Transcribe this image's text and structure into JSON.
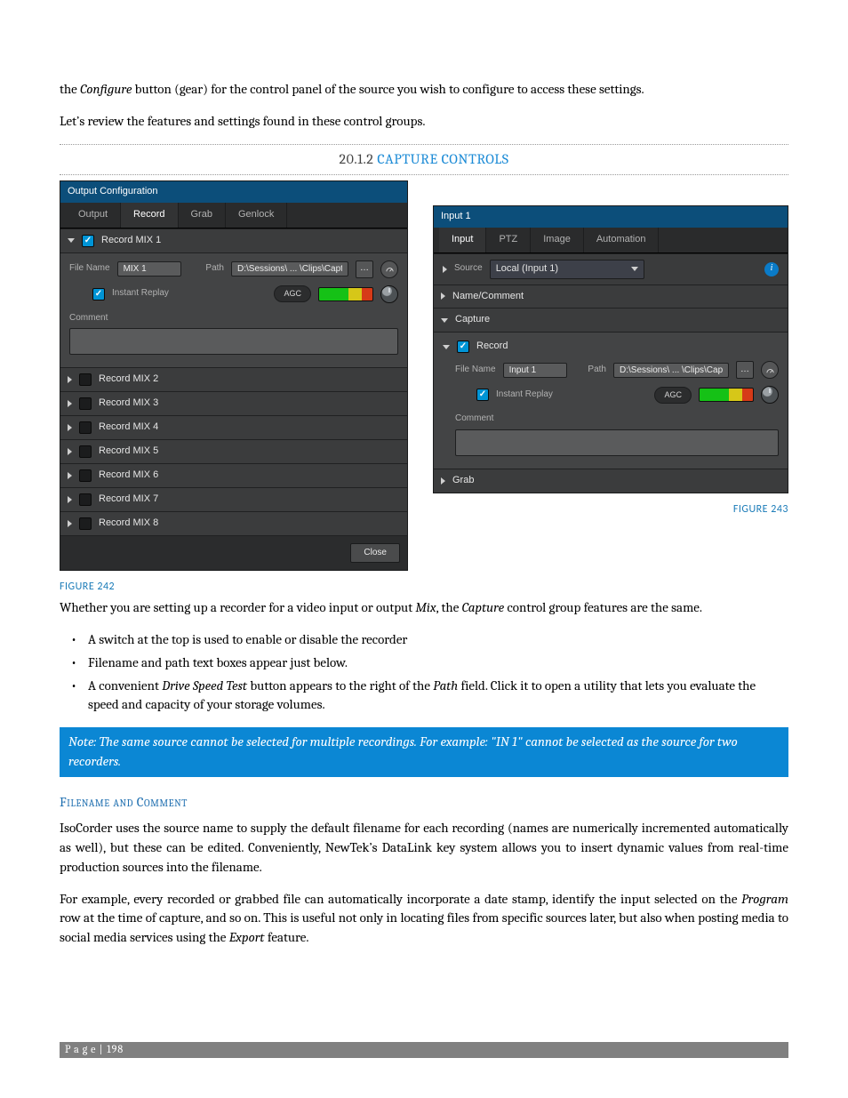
{
  "intro1_a": "the ",
  "intro1_b": "Configure",
  "intro1_c": " button (gear) for the control panel of the source you wish to configure to access these settings.",
  "intro2": "Let’s review the features and settings found in these control groups.",
  "section_num": "20.1.2 ",
  "section_title": "CAPTURE CONTROLS",
  "fig_left_caption": "FIGURE 242",
  "fig_right_caption": "FIGURE 243",
  "left": {
    "title": "Output Configuration",
    "tabs": [
      "Output",
      "Record",
      "Grab",
      "Genlock"
    ],
    "active_tab_idx": 1,
    "mix1": {
      "header": "Record MIX 1",
      "file_label": "File Name",
      "file_value": "MIX 1",
      "path_label": "Path",
      "path_value": "D:\\Sessions\\ ... \\Clips\\Capture",
      "instant_replay": "Instant Replay",
      "agc": "AGC",
      "comment": "Comment"
    },
    "mix_rows": [
      "Record MIX 2",
      "Record MIX 3",
      "Record MIX 4",
      "Record MIX 5",
      "Record MIX 6",
      "Record MIX 7",
      "Record MIX 8"
    ],
    "close": "Close"
  },
  "right": {
    "title": "Input 1",
    "tabs": [
      "Input",
      "PTZ",
      "Image",
      "Automation"
    ],
    "active_tab_idx": 0,
    "source_label": "Source",
    "source_value": "Local (Input 1)",
    "name_comment": "Name/Comment",
    "capture": "Capture",
    "record": "Record",
    "file_label": "File Name",
    "file_value": "Input 1",
    "path_label": "Path",
    "path_value": "D:\\Sessions\\ ... \\Clips\\Capture",
    "instant_replay": "Instant Replay",
    "agc": "AGC",
    "comment": "Comment",
    "grab": "Grab"
  },
  "para_after_figs_a": "Whether you are setting up a recorder for a video input or output ",
  "para_after_figs_b": "Mix",
  "para_after_figs_c": ", the ",
  "para_after_figs_d": "Capture",
  "para_after_figs_e": " control group features are the same.",
  "bullets": {
    "b1": "A switch at the top is used to enable or disable the recorder",
    "b2": "Filename and path text boxes appear just below.",
    "b3_a": "A convenient ",
    "b3_b": "Drive Speed Test",
    "b3_c": " button appears to the right of the ",
    "b3_d": "Path",
    "b3_e": " field.  Click it to open a utility that lets you evaluate the speed and capacity of your storage volumes."
  },
  "note": "Note: The same source cannot be selected for multiple recordings. For example: \"IN 1\" cannot be selected as the source for two recorders.",
  "sub_head": "Filename and Comment",
  "sub_p1": "IsoCorder uses the source name to supply the default filename for each recording (names are numerically incremented automatically as well), but these can be edited. Conveniently, NewTek’s DataLink key system allows you to insert dynamic values from real-time production sources into the filename.",
  "sub_p2_a": "For example, every recorded or grabbed file can automatically incorporate a date stamp, identify the input selected on the ",
  "sub_p2_b": "Program",
  "sub_p2_c": " row at the time of capture, and so on. This is useful not only in locating files from specific sources later, but also when posting media to social media services using the ",
  "sub_p2_d": "Export",
  "sub_p2_e": " feature.",
  "footer_label": "Page",
  "footer_sep": " | ",
  "footer_page": "198"
}
